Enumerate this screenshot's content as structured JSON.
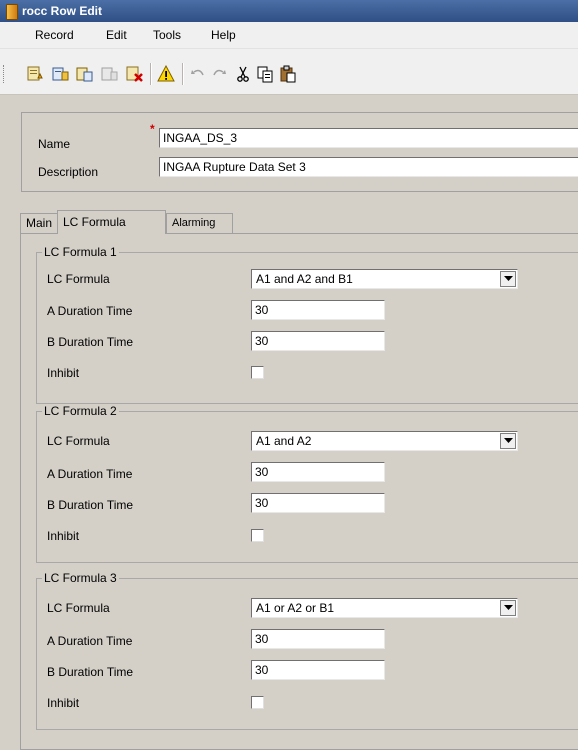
{
  "window": {
    "title": "rocc Row Edit"
  },
  "menu": [
    "Record",
    "Edit",
    "Tools",
    "Help"
  ],
  "toolbar_icons": [
    "new-record-icon",
    "copy-record-icon",
    "paste-record-icon",
    "disabled-record-icon",
    "delete-record-icon",
    "warning-icon",
    "undo-icon",
    "redo-icon",
    "cut-icon",
    "copy-icon",
    "paste-icon"
  ],
  "record": {
    "name_label": "Name",
    "name_value": "INGAA_DS_3",
    "required_mark": "*",
    "description_label": "Description",
    "description_value": "INGAA Rupture Data Set 3"
  },
  "tabs": [
    "Main",
    "LC Formula",
    "Alarming"
  ],
  "active_tab": "LC Formula",
  "groups": [
    {
      "title": "LC Formula 1",
      "formula_label": "LC Formula",
      "formula_value": "A1 and A2 and B1",
      "a_label": "A Duration Time",
      "a_value": "30",
      "b_label": "B Duration Time",
      "b_value": "30",
      "inhibit_label": "Inhibit",
      "inhibit_checked": false
    },
    {
      "title": "LC Formula 2",
      "formula_label": "LC Formula",
      "formula_value": "A1 and A2",
      "a_label": "A Duration Time",
      "a_value": "30",
      "b_label": "B Duration Time",
      "b_value": "30",
      "inhibit_label": "Inhibit",
      "inhibit_checked": false
    },
    {
      "title": "LC Formula 3",
      "formula_label": "LC Formula",
      "formula_value": "A1 or A2 or B1",
      "a_label": "A Duration Time",
      "a_value": "30",
      "b_label": "B Duration Time",
      "b_value": "30",
      "inhibit_label": "Inhibit",
      "inhibit_checked": false
    }
  ]
}
